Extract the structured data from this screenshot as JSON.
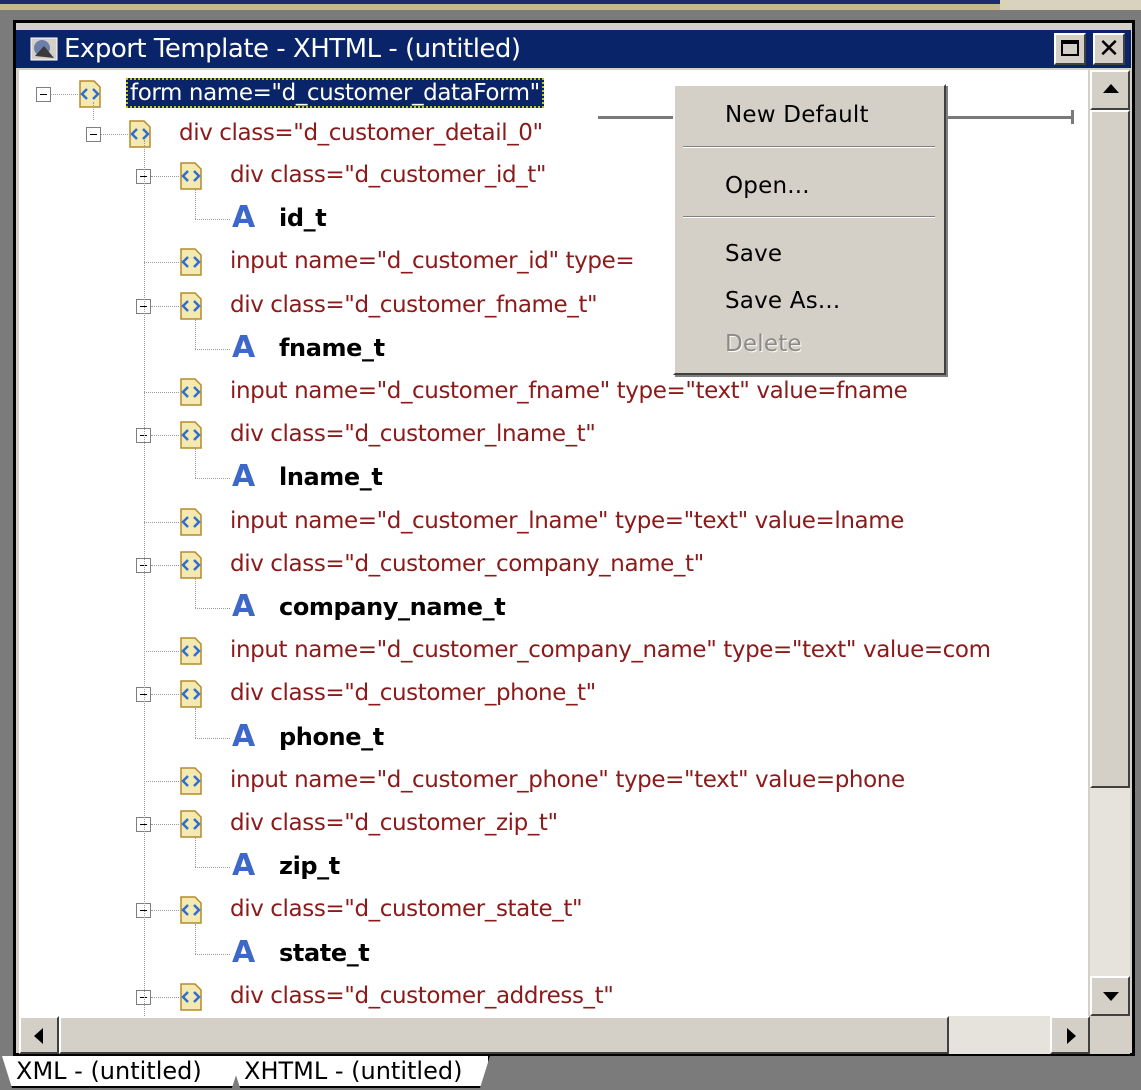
{
  "window": {
    "title": "Export Template - XHTML - (untitled)"
  },
  "tree": {
    "root": "form name=\"d_customer_dataForm\"",
    "detail": "div class=\"d_customer_detail_0\"",
    "rows": [
      {
        "kind": "div",
        "text": "div class=\"d_customer_id_t\""
      },
      {
        "kind": "attr",
        "text": "id_t"
      },
      {
        "kind": "input",
        "text": "input name=\"d_customer_id\" type="
      },
      {
        "kind": "div",
        "text": "div class=\"d_customer_fname_t\""
      },
      {
        "kind": "attr",
        "text": "fname_t"
      },
      {
        "kind": "input",
        "text": "input name=\"d_customer_fname\" type=\"text\" value=fname"
      },
      {
        "kind": "div",
        "text": "div class=\"d_customer_lname_t\""
      },
      {
        "kind": "attr",
        "text": "lname_t"
      },
      {
        "kind": "input",
        "text": "input name=\"d_customer_lname\" type=\"text\" value=lname"
      },
      {
        "kind": "div",
        "text": "div class=\"d_customer_company_name_t\""
      },
      {
        "kind": "attr",
        "text": "company_name_t"
      },
      {
        "kind": "input",
        "text": "input name=\"d_customer_company_name\" type=\"text\" value=com"
      },
      {
        "kind": "div",
        "text": "div class=\"d_customer_phone_t\""
      },
      {
        "kind": "attr",
        "text": "phone_t"
      },
      {
        "kind": "input",
        "text": "input name=\"d_customer_phone\" type=\"text\" value=phone"
      },
      {
        "kind": "div",
        "text": "div class=\"d_customer_zip_t\""
      },
      {
        "kind": "attr",
        "text": "zip_t"
      },
      {
        "kind": "div",
        "text": "div class=\"d_customer_state_t\""
      },
      {
        "kind": "attr",
        "text": "state_t"
      },
      {
        "kind": "div",
        "text": "div class=\"d_customer_address_t\""
      }
    ]
  },
  "context_menu": {
    "new_default": "New Default",
    "open": "Open...",
    "save": "Save",
    "save_as": "Save As...",
    "delete": "Delete"
  },
  "tabs": [
    "XML - (untitled)",
    "XHTML - (untitled)"
  ],
  "icons": {
    "title": "template-window-icon",
    "node": "xml-element-icon",
    "attr": "attribute-A-icon"
  },
  "colors": {
    "titlebar": "#0a246a",
    "tag_text": "#8b1a1a",
    "attr_icon": "#3d67c8"
  }
}
